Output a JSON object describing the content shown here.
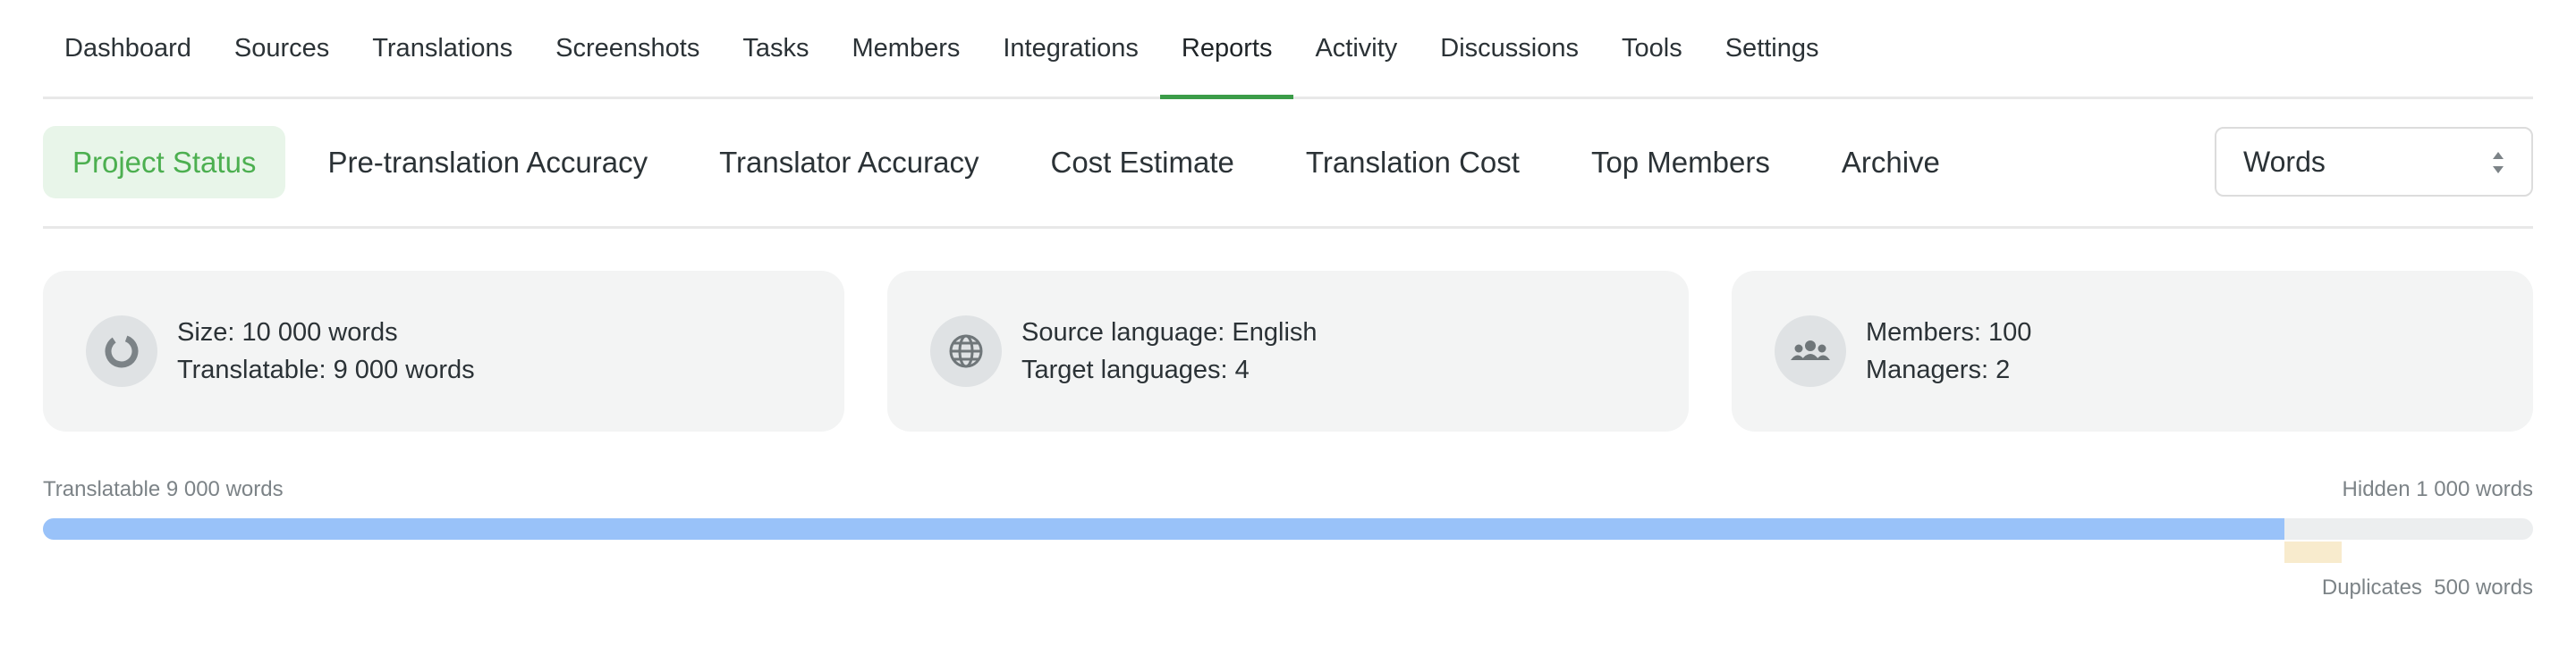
{
  "top_nav": {
    "items": [
      "Dashboard",
      "Sources",
      "Translations",
      "Screenshots",
      "Tasks",
      "Members",
      "Integrations",
      "Reports",
      "Activity",
      "Discussions",
      "Tools",
      "Settings"
    ],
    "active": "Reports"
  },
  "report_tabs": {
    "items": [
      "Project Status",
      "Pre-translation Accuracy",
      "Translator Accuracy",
      "Cost Estimate",
      "Translation Cost",
      "Top Members",
      "Archive"
    ],
    "active": "Project Status"
  },
  "unit_select": {
    "value": "Words"
  },
  "cards": [
    {
      "icon": "donut-chart-icon",
      "line1": "Size: 10 000 words",
      "line2": "Translatable: 9 000 words"
    },
    {
      "icon": "globe-icon",
      "line1": "Source language: English",
      "line2": "Target languages: 4"
    },
    {
      "icon": "people-icon",
      "line1": "Members: 100",
      "line2": "Managers: 2"
    }
  ],
  "progress": {
    "translatable_label": "Translatable 9 000 words",
    "hidden_label": "Hidden 1 000 words",
    "duplicates_label": "Duplicates",
    "duplicates_value": "500 words",
    "total_words": 10000,
    "translatable_words": 9000,
    "hidden_words": 1000,
    "duplicate_words": 500
  },
  "colors": {
    "accent": "#3b9c48",
    "translatable": "#99c2f9",
    "hidden": "#eceeef",
    "duplicates": "#f8ebcd"
  }
}
